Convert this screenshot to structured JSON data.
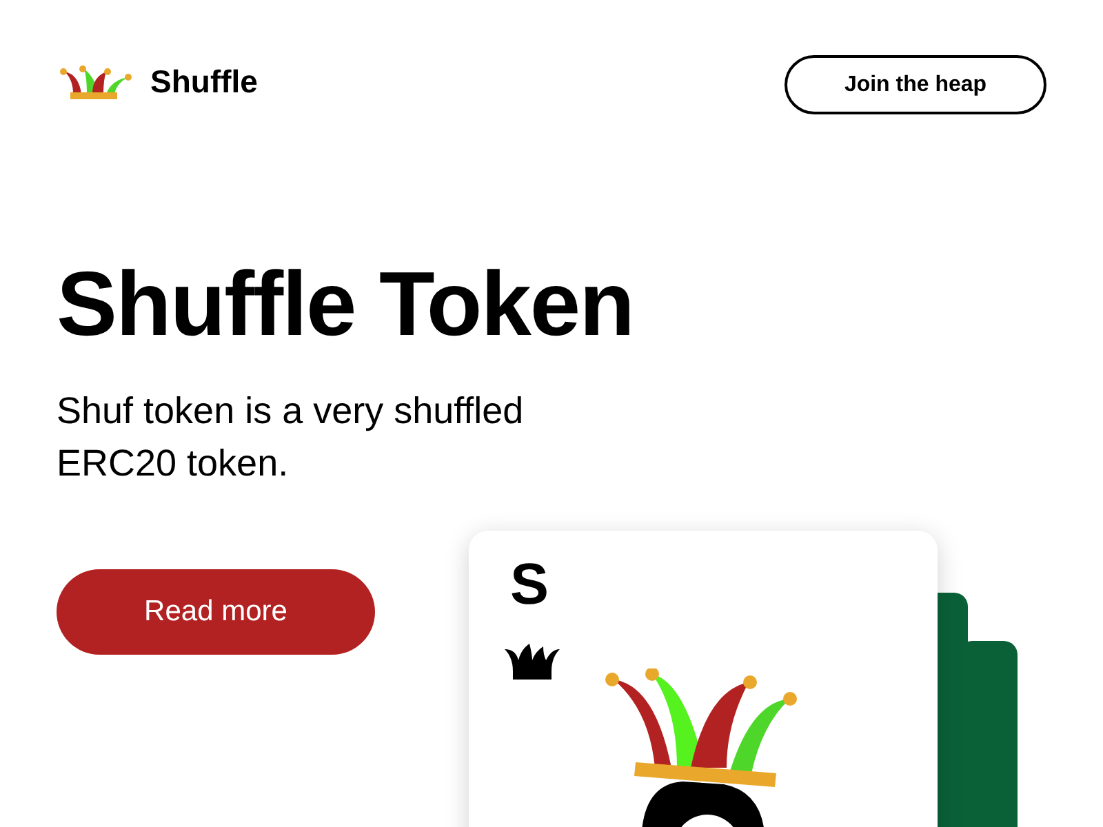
{
  "header": {
    "brand": "Shuffle",
    "cta": "Join the heap"
  },
  "hero": {
    "title": "Shuffle Token",
    "subtitle": "Shuf token is a very shuffled ERC20 token.",
    "button": "Read more"
  },
  "card": {
    "rank": "S"
  }
}
